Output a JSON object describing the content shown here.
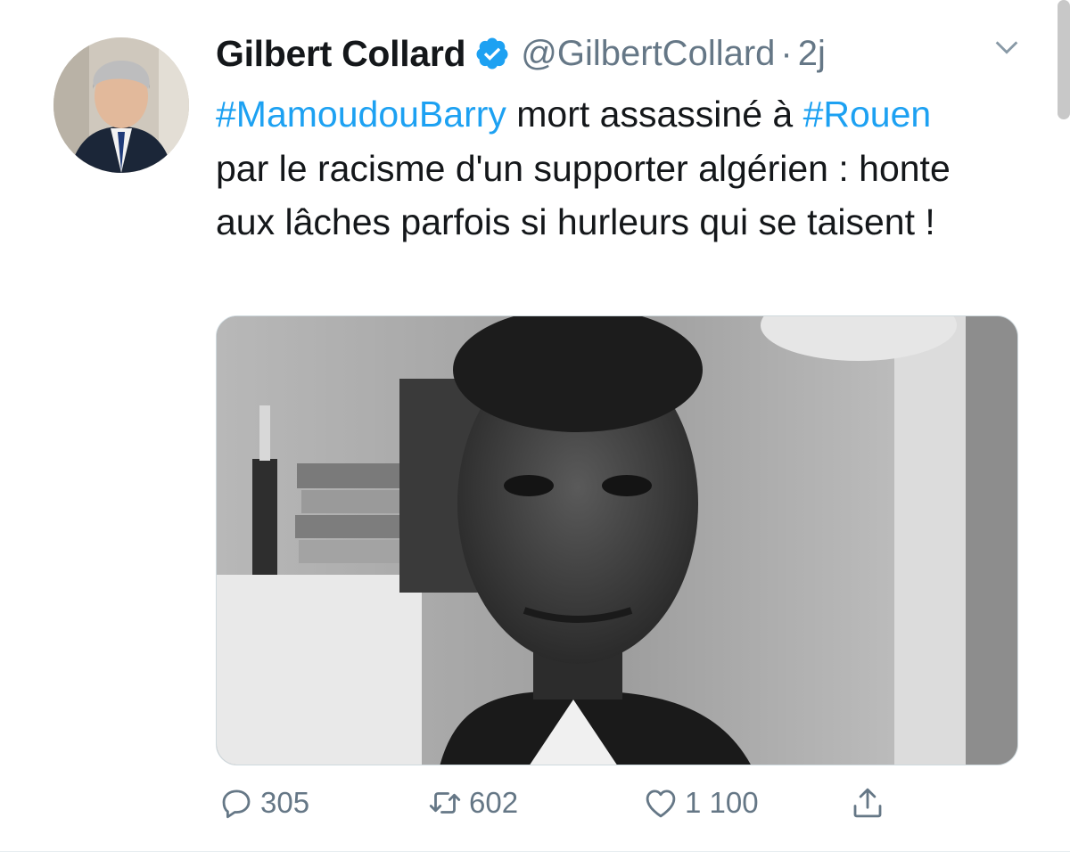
{
  "tweet": {
    "author": {
      "display_name": "Gilbert Collard",
      "handle": "@GilbertCollard",
      "verified": true,
      "separator": "·",
      "time_ago": "2j"
    },
    "text_segments": [
      {
        "type": "hashtag",
        "text": "#MamoudouBarry"
      },
      {
        "type": "text",
        "text": " mort assassiné à "
      },
      {
        "type": "hashtag",
        "text": "#Rouen"
      },
      {
        "type": "text",
        "text": " par le racisme d'un supporter algérien : honte aux lâches parfois si hurleurs qui se taisent !"
      }
    ],
    "media": {
      "kind": "photo",
      "style": "black-and-white portrait"
    },
    "actions": {
      "reply_count": "305",
      "retweet_count": "602",
      "like_count": "1 100"
    }
  },
  "icons": {
    "verified": "verified-badge-icon",
    "more": "chevron-down-icon",
    "reply": "reply-icon",
    "retweet": "retweet-icon",
    "like": "heart-icon",
    "share": "share-icon"
  },
  "colors": {
    "accent": "#1da1f2",
    "text_primary": "#14171a",
    "text_secondary": "#657786",
    "divider": "#e6ecf0"
  }
}
